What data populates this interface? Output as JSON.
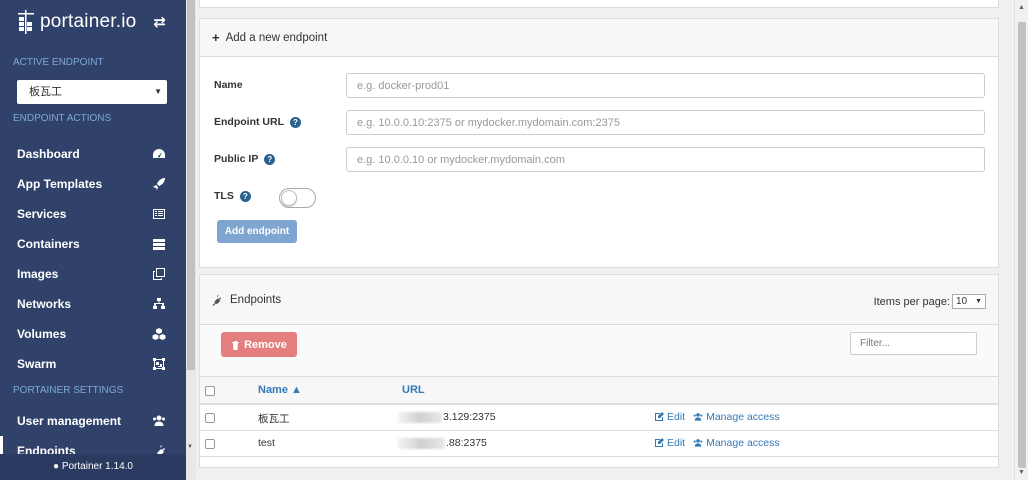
{
  "sidebar": {
    "brand": "portainer.io",
    "active_endpoint_heading": "ACTIVE ENDPOINT",
    "active_endpoint_value": "板瓦工",
    "endpoint_actions_heading": "ENDPOINT ACTIONS",
    "items": [
      {
        "label": "Dashboard",
        "icon": "tachometer-icon"
      },
      {
        "label": "App Templates",
        "icon": "rocket-icon"
      },
      {
        "label": "Services",
        "icon": "list-alt-icon"
      },
      {
        "label": "Containers",
        "icon": "server-icon"
      },
      {
        "label": "Images",
        "icon": "clone-icon"
      },
      {
        "label": "Networks",
        "icon": "sitemap-icon"
      },
      {
        "label": "Volumes",
        "icon": "cubes-icon"
      },
      {
        "label": "Swarm",
        "icon": "object-group-icon"
      }
    ],
    "settings_heading": "PORTAINER SETTINGS",
    "settings_items": [
      {
        "label": "User management",
        "icon": "users-icon"
      },
      {
        "label": "Endpoints",
        "icon": "plug-icon"
      }
    ],
    "footer": "Portainer 1.14.0"
  },
  "add_endpoint": {
    "title": "Add a new endpoint",
    "name_label": "Name",
    "name_placeholder": "e.g. docker-prod01",
    "url_label": "Endpoint URL",
    "url_placeholder": "e.g. 10.0.0.10:2375 or mydocker.mydomain.com:2375",
    "public_ip_label": "Public IP",
    "public_ip_placeholder": "e.g. 10.0.0.10 or mydocker.mydomain.com",
    "tls_label": "TLS",
    "submit_label": "Add endpoint"
  },
  "endpoints": {
    "title": "Endpoints",
    "items_per_page_label": "Items per page:",
    "items_per_page_value": "10",
    "remove_label": "Remove",
    "filter_placeholder": "Filter...",
    "col_name": "Name",
    "col_url": "URL",
    "rows": [
      {
        "name": "板瓦工",
        "url": "3.129:2375",
        "edit": "Edit",
        "manage": "Manage access"
      },
      {
        "name": "test",
        "url": ".88:2375",
        "edit": "Edit",
        "manage": "Manage access"
      }
    ]
  },
  "colors": {
    "sidebar_bg": "#30426a",
    "accent": "#337ab7",
    "danger": "#e57f7f",
    "primary_disabled": "#7ea6d0"
  }
}
